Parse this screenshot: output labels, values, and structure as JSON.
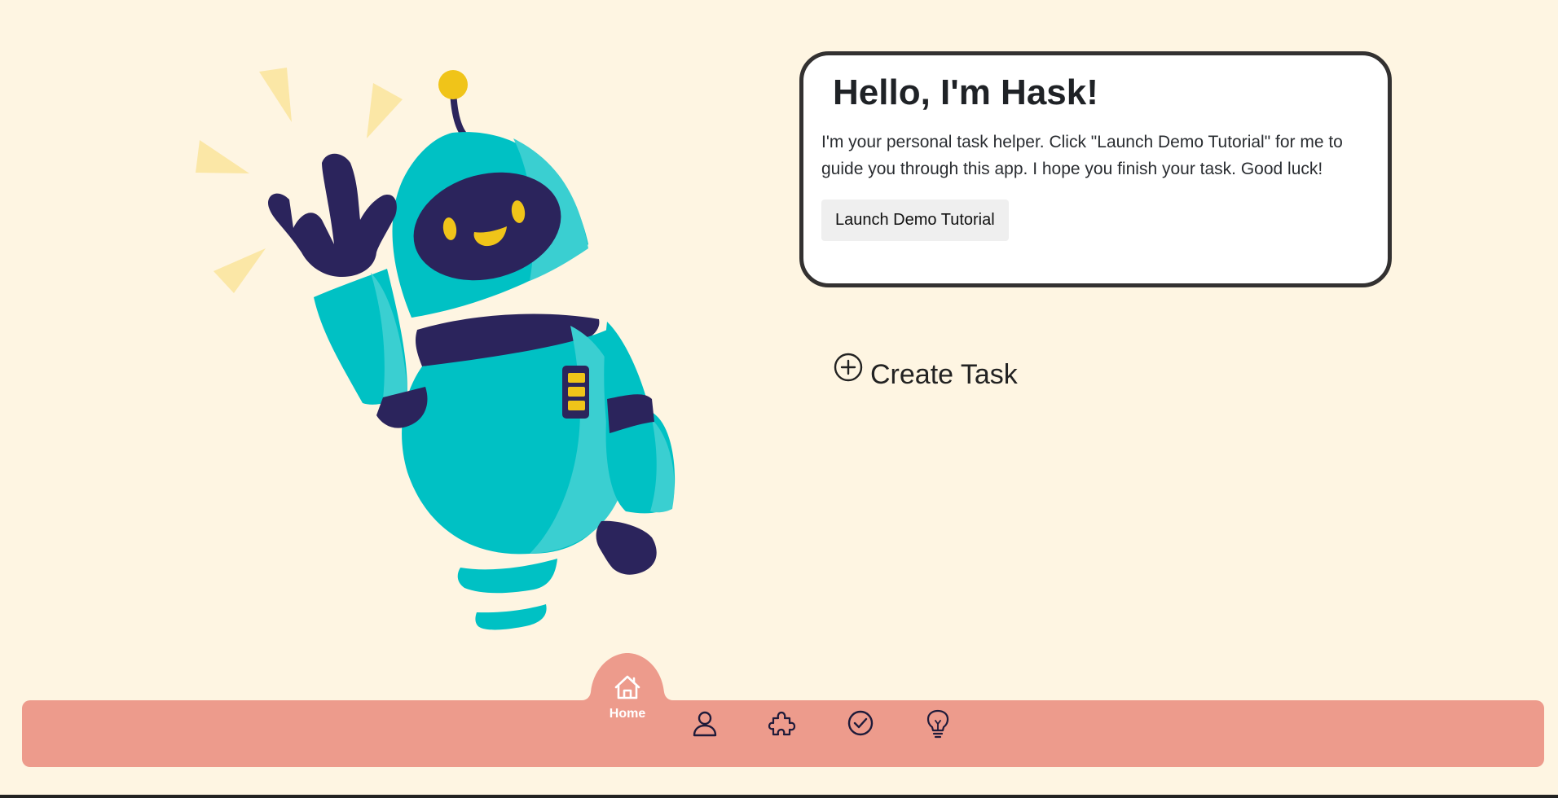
{
  "hello_card": {
    "title": "Hello, I'm Hask!",
    "text": "I'm your personal task helper. Click \"Launch Demo Tutorial\" for me to guide you through this app. I hope you finish your task. Good luck!",
    "button_label": "Launch Demo Tutorial"
  },
  "create_task": {
    "label": "Create Task",
    "icon": "plus-circle-icon"
  },
  "nav": {
    "home_label": "Home",
    "items": [
      {
        "icon": "home-icon",
        "active": true
      },
      {
        "icon": "user-icon"
      },
      {
        "icon": "puzzle-icon"
      },
      {
        "icon": "check-circle-icon"
      },
      {
        "icon": "lightbulb-icon"
      }
    ]
  },
  "colors": {
    "background": "#fef5e2",
    "nav": "#ed9b8c",
    "robot_body": "#00c1c4",
    "robot_dark": "#2b245c",
    "robot_accent": "#f0c419",
    "card_border": "#333131"
  }
}
